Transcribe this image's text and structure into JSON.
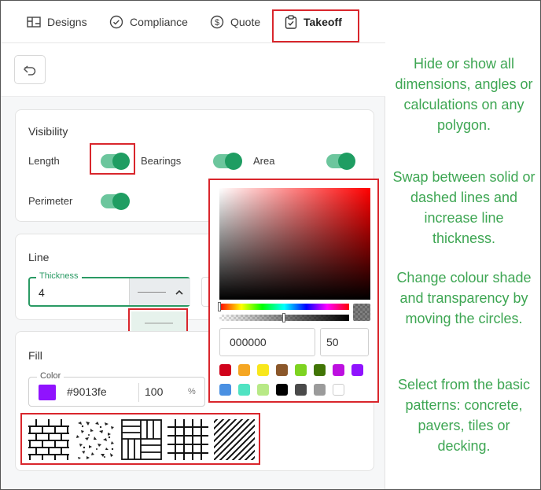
{
  "tabs": [
    {
      "label": "Designs",
      "icon": "designs-icon"
    },
    {
      "label": "Compliance",
      "icon": "check-circle-icon"
    },
    {
      "label": "Quote",
      "icon": "dollar-icon"
    },
    {
      "label": "Takeoff",
      "icon": "clipboard-check-icon",
      "active": true
    }
  ],
  "visibility": {
    "title": "Visibility",
    "items": [
      {
        "label": "Length",
        "on": true
      },
      {
        "label": "Bearings",
        "on": true
      },
      {
        "label": "Area",
        "on": true
      },
      {
        "label": "Perimeter",
        "on": true
      }
    ]
  },
  "line": {
    "title": "Line",
    "thickness_label": "Thickness",
    "thickness_value": "4",
    "style_options": [
      "solid",
      "dashed"
    ],
    "selected_style": "solid"
  },
  "fill": {
    "title": "Fill",
    "color_label": "Color",
    "color_hex": "#9013fe",
    "opacity": "100",
    "opacity_unit": "%",
    "patterns": [
      "pavers",
      "concrete",
      "tiles-parquet",
      "grid-tiles",
      "decking-diagonal"
    ]
  },
  "picker": {
    "hex": "000000",
    "alpha": "50",
    "hue_color": "#ff0000",
    "presets": [
      "#d0021b",
      "#f5a623",
      "#f8e71c",
      "#8b572a",
      "#7ed321",
      "#417505",
      "#bd10e0",
      "#9013fe",
      "#4a90e2",
      "#50e3c2",
      "#b8e986",
      "#000000",
      "#4a4a4a",
      "#9b9b9b",
      "#ffffff"
    ]
  },
  "notes": [
    "Hide or show all dimensions, angles or calculations on any polygon.",
    "Swap between solid or dashed lines and increase line thickness.",
    "Change colour shade and transparency by moving the circles.",
    "Select from the basic patterns: concrete, pavers, tiles or decking."
  ],
  "colors": {
    "accent_green": "#1f9d62",
    "annotation_red": "#d9262c",
    "note_green": "#3ea653"
  }
}
